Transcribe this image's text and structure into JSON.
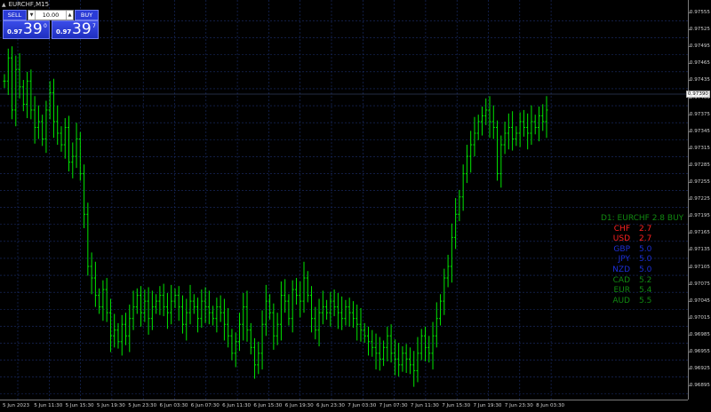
{
  "window": {
    "title": "EURCHF,M15"
  },
  "one_click": {
    "sell_label": "SELL",
    "buy_label": "BUY",
    "lot_value": "10.00",
    "bid": {
      "small": "0.97",
      "big": "39",
      "sup": "0"
    },
    "ask": {
      "small": "0.97",
      "big": "39",
      "sup": "7"
    }
  },
  "price_axis": {
    "labels": [
      "0.97555",
      "0.97525",
      "0.97495",
      "0.97465",
      "0.97435",
      "0.97405",
      "0.97375",
      "0.97345",
      "0.97315",
      "0.97285",
      "0.97255",
      "0.97225",
      "0.97195",
      "0.97165",
      "0.97135",
      "0.97105",
      "0.97075",
      "0.97045",
      "0.97015",
      "0.96985",
      "0.96955",
      "0.96925",
      "0.96895"
    ],
    "current": "0.97390"
  },
  "time_axis": {
    "labels": [
      "5 Jun 2023",
      "5 Jun 11:30",
      "5 Jun 15:30",
      "5 Jun 19:30",
      "5 Jun 23:30",
      "6 Jun 03:30",
      "6 Jun 07:30",
      "6 Jun 11:30",
      "6 Jun 15:30",
      "6 Jun 19:30",
      "6 Jun 23:30",
      "7 Jun 03:30",
      "7 Jun 07:30",
      "7 Jun 11:30",
      "7 Jun 15:30",
      "7 Jun 19:30",
      "7 Jun 23:30",
      "8 Jun 03:30"
    ]
  },
  "strength_panel": {
    "title": "D1: EURCHF 2.8 BUY",
    "rows": [
      {
        "cur": "CHF",
        "val": "2.7",
        "color": "#ff2020"
      },
      {
        "cur": "USD",
        "val": "2.7",
        "color": "#ff2020"
      },
      {
        "cur": "GBP",
        "val": "5.0",
        "color": "#1c2fd6"
      },
      {
        "cur": "JPY",
        "val": "5.0",
        "color": "#1c2fd6"
      },
      {
        "cur": "NZD",
        "val": "5.0",
        "color": "#1c2fd6"
      },
      {
        "cur": "CAD",
        "val": "5.2",
        "color": "#118a11"
      },
      {
        "cur": "EUR",
        "val": "5.4",
        "color": "#118a11"
      },
      {
        "cur": "AUD",
        "val": "5.5",
        "color": "#118a11"
      }
    ]
  },
  "colors": {
    "bars": "#00e600",
    "grid": "#1c2f6e",
    "background": "#000000"
  },
  "chart_data": {
    "type": "ohlc",
    "symbol": "EURCHF",
    "timeframe": "M15",
    "ylim": [
      0.9688,
      0.9757
    ],
    "series": [
      {
        "values": [
          0.9743,
          0.9747,
          0.9738,
          0.9745,
          0.9742,
          0.9739,
          0.9743,
          0.9738,
          0.9735,
          0.9736,
          0.9733,
          0.9738,
          0.9741,
          0.9736,
          0.9734,
          0.9732,
          0.9735,
          0.9729,
          0.973,
          0.9733,
          0.9727,
          0.972,
          0.9711,
          0.9709,
          0.9706,
          0.9704,
          0.9707,
          0.9703,
          0.9699,
          0.97,
          0.9698,
          0.9701,
          0.9699,
          0.9702,
          0.9704,
          0.9706,
          0.9703,
          0.9705,
          0.9702,
          0.9704,
          0.9705,
          0.9706,
          0.9704,
          0.9703,
          0.9705,
          0.9706,
          0.9704,
          0.9701,
          0.9703,
          0.9705,
          0.9704,
          0.9702,
          0.9705,
          0.9704,
          0.9703,
          0.9702,
          0.9704,
          0.9703,
          0.9701,
          0.9699,
          0.9696,
          0.9698,
          0.9701,
          0.9704,
          0.97,
          0.9697,
          0.9694,
          0.9696,
          0.9701,
          0.9705,
          0.9703,
          0.9699,
          0.9701,
          0.9706,
          0.9705,
          0.9702,
          0.9707,
          0.9706,
          0.9705,
          0.9709,
          0.9706,
          0.9702,
          0.97,
          0.9703,
          0.9704,
          0.9703,
          0.9705,
          0.9704,
          0.9703,
          0.9702,
          0.9704,
          0.9703,
          0.9702,
          0.9701,
          0.97,
          0.9699,
          0.9698,
          0.9697,
          0.9696,
          0.9695,
          0.9697,
          0.9699,
          0.9696,
          0.9695,
          0.9694,
          0.9696,
          0.9695,
          0.9694,
          0.9693,
          0.9696,
          0.9699,
          0.9697,
          0.9696,
          0.9699,
          0.9702,
          0.9705,
          0.9709,
          0.9711,
          0.9716,
          0.972,
          0.9723,
          0.9727,
          0.973,
          0.9732,
          0.9734,
          0.9736,
          0.9737,
          0.9738,
          0.9736,
          0.9735,
          0.9727,
          0.9732,
          0.9734,
          0.9735,
          0.9733,
          0.9734,
          0.9736,
          0.9735,
          0.9734,
          0.9736,
          0.9735,
          0.9737,
          0.9736,
          0.9738
        ]
      }
    ]
  }
}
